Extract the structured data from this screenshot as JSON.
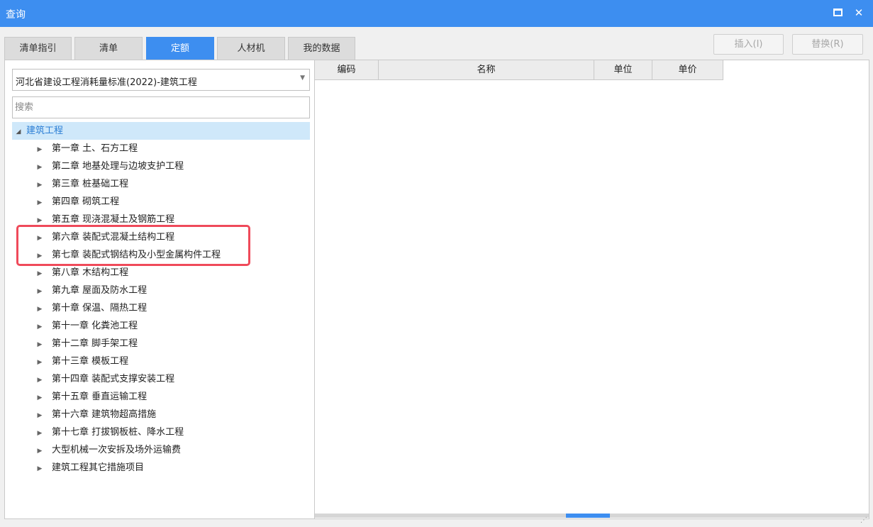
{
  "window": {
    "title": "查询"
  },
  "tabs": [
    {
      "label": "清单指引",
      "active": false
    },
    {
      "label": "清单",
      "active": false
    },
    {
      "label": "定额",
      "active": true
    },
    {
      "label": "人材机",
      "active": false
    },
    {
      "label": "我的数据",
      "active": false
    }
  ],
  "actions": {
    "insert_label": "插入(I)",
    "replace_label": "替换(R)"
  },
  "left": {
    "standard_select": "河北省建设工程消耗量标准(2022)-建筑工程",
    "search_placeholder": "搜索",
    "tree_root": "建筑工程",
    "chapters": [
      "第一章 土、石方工程",
      "第二章 地基处理与边坡支护工程",
      "第三章 桩基础工程",
      "第四章 砌筑工程",
      "第五章 现浇混凝土及钢筋工程",
      "第六章 装配式混凝土结构工程",
      "第七章 装配式钢结构及小型金属构件工程",
      "第八章 木结构工程",
      "第九章 屋面及防水工程",
      "第十章 保温、隔热工程",
      "第十一章 化粪池工程",
      "第十二章 脚手架工程",
      "第十三章 模板工程",
      "第十四章 装配式支撑安装工程",
      "第十五章 垂直运输工程",
      "第十六章 建筑物超高措施",
      "第十七章 打拔钢板桩、降水工程",
      "大型机械一次安拆及场外运输费",
      "建筑工程其它措施项目"
    ]
  },
  "table": {
    "columns": [
      "编码",
      "名称",
      "单位",
      "单价"
    ]
  },
  "colors": {
    "accent": "#3d8ef0",
    "highlight_border": "#ef4a5a",
    "selected_row": "#cfe8fa"
  },
  "icons": {
    "maximize": "maximize-icon",
    "close": "close-icon",
    "expand": "triangle-right-icon",
    "collapse": "triangle-down-icon"
  }
}
